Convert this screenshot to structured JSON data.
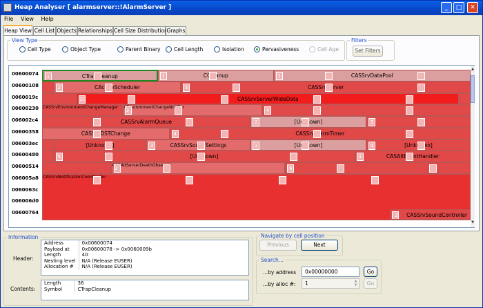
{
  "window": {
    "title": "Heap Analyser [ alarmserver::!AlarmServer ]"
  },
  "menu": [
    "File",
    "View",
    "Help"
  ],
  "tabs": [
    "Heap View",
    "Cell List",
    "Objects",
    "Relationships",
    "Cell Size Distributions",
    "Graphs"
  ],
  "view_type": {
    "label": "View Type",
    "options": [
      {
        "label": "Cell Type",
        "selected": false,
        "enabled": true
      },
      {
        "label": "Object Type",
        "selected": false,
        "enabled": true
      },
      {
        "label": "Parent Binary",
        "selected": false,
        "enabled": true
      },
      {
        "label": "Cell Length",
        "selected": false,
        "enabled": true
      },
      {
        "label": "Isolation",
        "selected": false,
        "enabled": true
      },
      {
        "label": "Pervasiveness",
        "selected": true,
        "enabled": true
      },
      {
        "label": "Cell Age",
        "selected": false,
        "enabled": false
      }
    ]
  },
  "filters": {
    "label": "Filters",
    "button": "Set Filters"
  },
  "heap": {
    "addresses": [
      "00600074",
      "00600108",
      "0060019c",
      "00600230",
      "006002c4",
      "00600358",
      "006003ec",
      "00600480",
      "00600514",
      "006005a8",
      "0060063c",
      "006006d0",
      "00600764"
    ],
    "cells": [
      {
        "row": 0,
        "start": 0,
        "span": 10,
        "label": "CTrapCleanup",
        "num": "1",
        "color": "#dc9f9f",
        "sel": true
      },
      {
        "row": 0,
        "start": 10,
        "span": 10,
        "label": "CCleanup",
        "num": "1",
        "color": "#dc9f9f"
      },
      {
        "row": 0,
        "start": 20,
        "span": 17,
        "label": "CASSrvDataPool",
        "num": "1",
        "color": "#dc9f9f"
      },
      {
        "row": 1,
        "start": 0,
        "span": 1,
        "label": "",
        "num": "",
        "color": "#e14848"
      },
      {
        "row": 1,
        "start": 1,
        "span": 11,
        "label": "CActiveScheduler",
        "num": "2",
        "color": "#e36b6b"
      },
      {
        "row": 1,
        "start": 12,
        "span": 25,
        "label": "CASSrvServer",
        "num": "5",
        "color": "#e14848"
      },
      {
        "row": 2,
        "start": 0,
        "span": 3,
        "label": "",
        "num": "",
        "color": "#e14848"
      },
      {
        "row": 2,
        "start": 3,
        "span": 33,
        "label": "CASSrvServerWideData",
        "num": "10",
        "color": "#f21c1c"
      },
      {
        "row": 2,
        "start": 36,
        "span": 1,
        "label": "",
        "num": "",
        "color": "#e14848"
      },
      {
        "row": 3,
        "start": 0,
        "span": 7,
        "label": "CASSrvEnvironmentChangeManager",
        "num": "",
        "color": "#e14848"
      },
      {
        "row": 3,
        "start": 7,
        "span": 12,
        "label": "CEnvironmentChangeNotifier",
        "num": "3",
        "color": "#e36b6b"
      },
      {
        "row": 3,
        "start": 19,
        "span": 18,
        "label": "",
        "num": "4",
        "color": "#e14848"
      },
      {
        "row": 4,
        "start": 0,
        "span": 18,
        "label": "CASSrvAlarmQueue",
        "num": "",
        "color": "#e14848"
      },
      {
        "row": 4,
        "start": 18,
        "span": 10,
        "label": "[Unknown]",
        "num": "2",
        "color": "#dc9f9f"
      },
      {
        "row": 4,
        "start": 28,
        "span": 9,
        "label": "",
        "num": "3",
        "color": "#e14848"
      },
      {
        "row": 5,
        "start": 0,
        "span": 11,
        "label": "CASSrvDSTChange",
        "num": "",
        "color": "#e36b6b"
      },
      {
        "row": 5,
        "start": 11,
        "span": 26,
        "label": "CASSrvAlarmTimer",
        "num": "4",
        "color": "#e14848"
      },
      {
        "row": 6,
        "start": 0,
        "span": 1,
        "label": "",
        "num": "",
        "color": "#e14848"
      },
      {
        "row": 6,
        "start": 1,
        "span": 8,
        "label": "[Unknown]",
        "num": "",
        "color": "#e14848"
      },
      {
        "row": 6,
        "start": 9,
        "span": 9,
        "label": "CASSrvSoundSettings",
        "num": "3",
        "color": "#e36b6b"
      },
      {
        "row": 6,
        "start": 18,
        "span": 10,
        "label": "[Unknown]",
        "num": "1",
        "color": "#dc9f9f"
      },
      {
        "row": 6,
        "start": 28,
        "span": 9,
        "label": "[Unknown]",
        "num": "4",
        "color": "#e14848"
      },
      {
        "row": 7,
        "start": 0,
        "span": 1,
        "label": "",
        "num": "",
        "color": "#e14848"
      },
      {
        "row": 7,
        "start": 1,
        "span": 26,
        "label": "[Unknown]",
        "num": "5",
        "color": "#e14848"
      },
      {
        "row": 7,
        "start": 27,
        "span": 10,
        "label": "CASAltEventHandler",
        "num": "4",
        "color": "#e14848"
      },
      {
        "row": 8,
        "start": 0,
        "span": 6,
        "label": "",
        "num": "",
        "color": "#e14848"
      },
      {
        "row": 8,
        "start": 6,
        "span": 15,
        "label": "CASAltServerDeathObserver",
        "num": "3",
        "color": "#e36b6b"
      },
      {
        "row": 8,
        "start": 21,
        "span": 16,
        "label": "",
        "num": "6",
        "color": "#e14848"
      },
      {
        "row": 9,
        "start": 0,
        "span": 37,
        "label": "CASSrvNotificationCoordinator",
        "num": "",
        "color": "#e83030",
        "rows": 4
      }
    ],
    "last_row_cell": {
      "label": "CASSrvSoundController",
      "num": "3"
    }
  },
  "information": {
    "label": "Information",
    "header_label": "Header:",
    "contents_label": "Contents:",
    "header": [
      {
        "k": "Address",
        "v": "0x00600074"
      },
      {
        "k": "Payload at",
        "v": "0x00600078 -> 0x0060009b"
      },
      {
        "k": "Length",
        "v": "40"
      },
      {
        "k": "Nesting level",
        "v": "N/A (Release EUSER)"
      },
      {
        "k": "Allocation #",
        "v": "N/A (Release EUSER)"
      }
    ],
    "contents": [
      {
        "k": "Length",
        "v": "36"
      },
      {
        "k": "Symbol",
        "v": "CTrapCleanup"
      }
    ]
  },
  "navigate": {
    "label": "Navigate by cell position",
    "previous": "Previous",
    "next": "Next"
  },
  "search": {
    "label": "Search...",
    "by_address_label": "...by address",
    "by_address_value": "0x00000000",
    "by_alloc_label": "...by alloc #:",
    "by_alloc_value": "1",
    "go": "Go"
  }
}
